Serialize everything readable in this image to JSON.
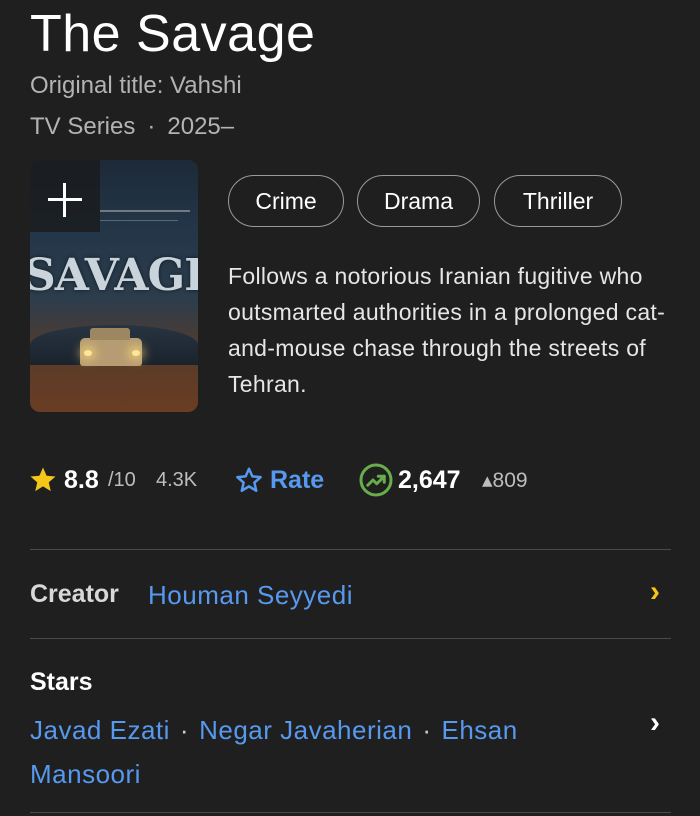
{
  "header": {
    "title": "The Savage",
    "original_title": "Original title: Vahshi",
    "type": "TV Series",
    "separator": "·",
    "years": "2025–"
  },
  "genres": [
    "Crime",
    "Drama",
    "Thriller"
  ],
  "description": "Follows a notorious Iranian fugitive who outsmarted authorities in a prolonged cat-and-mouse chase through the streets of Tehran.",
  "poster": {
    "word": "SAVAGE",
    "icon": "plus-icon"
  },
  "stats": {
    "rating": "8.8",
    "rating_max": "/10",
    "votes": "4.3K",
    "rate_label": "Rate",
    "popularity": "2,647",
    "popularity_delta": "▴809",
    "colors": {
      "star": "#f5c518",
      "rate": "#5799ef",
      "trend": "#67ad4b"
    }
  },
  "creator": {
    "label": "Creator",
    "name": "Houman Seyyedi"
  },
  "stars": {
    "label": "Stars",
    "names": [
      "Javad Ezati",
      "Negar Javaherian",
      "Ehsan Mansoori"
    ]
  },
  "colors": {
    "accent_link": "#5799ef",
    "chevron_yellow": "#f5c518",
    "background": "#1f1f1f"
  }
}
